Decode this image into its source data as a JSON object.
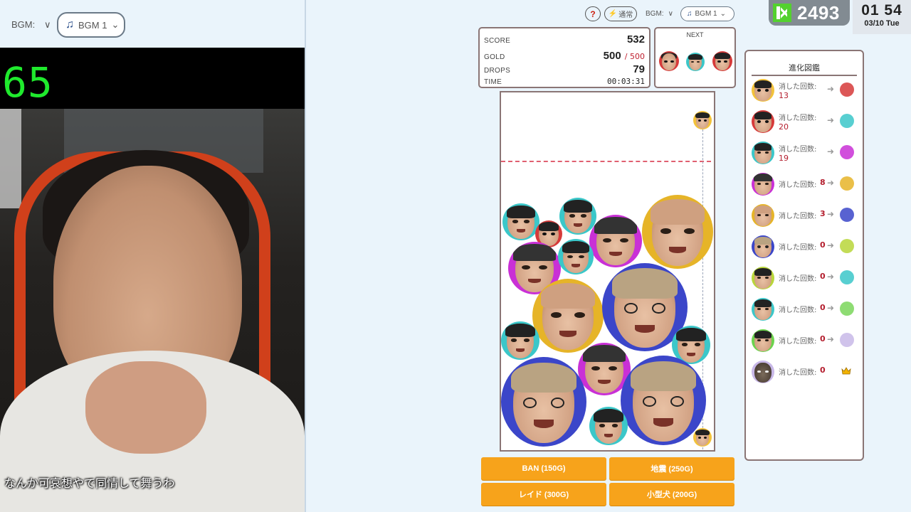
{
  "left_panel": {
    "bgm_label": "BGM:",
    "bgm_caret": "∨",
    "bgm_value": "BGM 1",
    "counter": "65",
    "subtitle": "なんか可哀想やで同情して舞うわ"
  },
  "game": {
    "help_label": "?",
    "speed_label": "通常",
    "bgm_label": "BGM:",
    "bgm_caret": "∨",
    "bgm_value": "BGM 1",
    "score": {
      "score_label": "SCORE",
      "score_value": "532",
      "gold_label": "GOLD",
      "gold_value": "500",
      "gold_max": "/ 500",
      "drops_label": "DROPS",
      "drops_value": "79",
      "time_label": "TIME",
      "time_value": "00:03:31"
    },
    "next_label": "NEXT",
    "actions": {
      "ban": "BAN (150G)",
      "quake": "地震 (250G)",
      "raid": "レイド (300G)",
      "dog": "小型犬 (200G)"
    }
  },
  "evolution": {
    "title": "進化図鑑",
    "count_label": "消した回数:",
    "rows": [
      {
        "count": "13"
      },
      {
        "count": "20"
      },
      {
        "count": "19"
      },
      {
        "count": "8"
      },
      {
        "count": "3"
      },
      {
        "count": "0"
      },
      {
        "count": "0"
      },
      {
        "count": "0"
      },
      {
        "count": "0"
      },
      {
        "count": "0"
      }
    ]
  },
  "overlay": {
    "points": "2493",
    "time": "01 54",
    "date": "03/10 Tue"
  },
  "colors": {
    "accent_orange": "#f7a31b",
    "gold_red": "#c02030",
    "counter_green": "#1fea2d",
    "danger_line": "#e06070"
  }
}
